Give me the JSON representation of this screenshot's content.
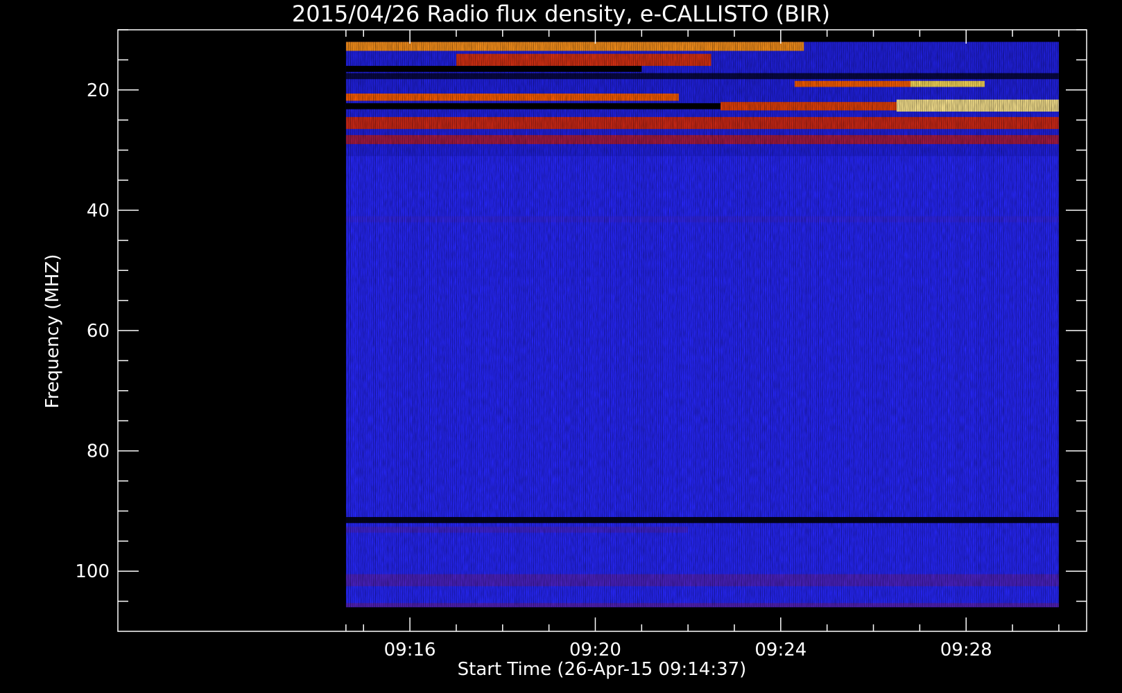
{
  "chart_data": {
    "type": "heatmap",
    "title": "2015/04/26  Radio flux density, e-CALLISTO (BIR)",
    "xlabel": "Start Time (26-Apr-15 09:14:37)",
    "ylabel": "Frequency (MHZ)",
    "x_range_minutes": [
      9.7,
      30.6
    ],
    "x_data_range_minutes": [
      14.62,
      30.0
    ],
    "y_range_mhz": [
      10,
      110
    ],
    "y_data_range_mhz": [
      12,
      106
    ],
    "y_inverted": true,
    "x_ticks": [
      {
        "minute": 16,
        "label": "09:16"
      },
      {
        "minute": 20,
        "label": "09:20"
      },
      {
        "minute": 24,
        "label": "09:24"
      },
      {
        "minute": 28,
        "label": "09:28"
      }
    ],
    "x_minor_ticks": [
      14.62,
      15,
      17,
      18,
      19,
      21,
      22,
      23,
      25,
      26,
      27,
      29,
      30
    ],
    "y_ticks": [
      {
        "mhz": 20,
        "label": "20"
      },
      {
        "mhz": 40,
        "label": "40"
      },
      {
        "mhz": 60,
        "label": "60"
      },
      {
        "mhz": 80,
        "label": "80"
      },
      {
        "mhz": 100,
        "label": "100"
      }
    ],
    "y_minor_ticks": [
      10,
      15,
      25,
      30,
      35,
      45,
      50,
      55,
      65,
      70,
      75,
      85,
      90,
      95,
      105
    ],
    "colormap": [
      "#000000",
      "#1a1acc",
      "#2828ff",
      "#8a1a6e",
      "#c81e1e",
      "#ff5a00",
      "#ffd83c",
      "#ffffff"
    ],
    "intensity_bands": [
      {
        "f0": 12,
        "f1": 13.5,
        "t0": 14.62,
        "t1": 24.5,
        "level": 0.78
      },
      {
        "f0": 14,
        "f1": 16,
        "t0": 17,
        "t1": 22.5,
        "level": 0.62
      },
      {
        "f0": 16,
        "f1": 17,
        "t0": 14.62,
        "t1": 21,
        "level": 0.0
      },
      {
        "f0": 17.2,
        "f1": 18.2,
        "t0": 14.62,
        "t1": 30,
        "level": 0.05
      },
      {
        "f0": 18.5,
        "f1": 19.5,
        "t0": 24.3,
        "t1": 27,
        "level": 0.72
      },
      {
        "f0": 18.5,
        "f1": 19.5,
        "t0": 26.8,
        "t1": 28.4,
        "level": 0.88
      },
      {
        "f0": 20.6,
        "f1": 21.8,
        "t0": 14.62,
        "t1": 21.8,
        "level": 0.72
      },
      {
        "f0": 22.2,
        "f1": 23.2,
        "t0": 14.62,
        "t1": 22.7,
        "level": 0.0
      },
      {
        "f0": 22.0,
        "f1": 23.4,
        "t0": 22.7,
        "t1": 26.5,
        "level": 0.66
      },
      {
        "f0": 21.6,
        "f1": 23.6,
        "t0": 26.5,
        "t1": 30,
        "level": 0.92
      },
      {
        "f0": 24.5,
        "f1": 26.5,
        "t0": 14.62,
        "t1": 30,
        "level": 0.6
      },
      {
        "f0": 27.5,
        "f1": 29,
        "t0": 14.62,
        "t1": 30,
        "level": 0.5
      },
      {
        "f0": 41,
        "f1": 42,
        "t0": 14.62,
        "t1": 30,
        "level": 0.3
      },
      {
        "f0": 50,
        "f1": 51,
        "t0": 14.62,
        "t1": 23,
        "level": 0.28
      },
      {
        "f0": 91,
        "f1": 92,
        "t0": 14.62,
        "t1": 30,
        "level": 0.02
      },
      {
        "f0": 92.6,
        "f1": 93.6,
        "t0": 14.62,
        "t1": 22,
        "level": 0.32
      },
      {
        "f0": 100.5,
        "f1": 102.5,
        "t0": 14.62,
        "t1": 30,
        "level": 0.34
      },
      {
        "f0": 105.3,
        "f1": 106,
        "t0": 14.62,
        "t1": 30,
        "level": 0.35
      }
    ]
  }
}
